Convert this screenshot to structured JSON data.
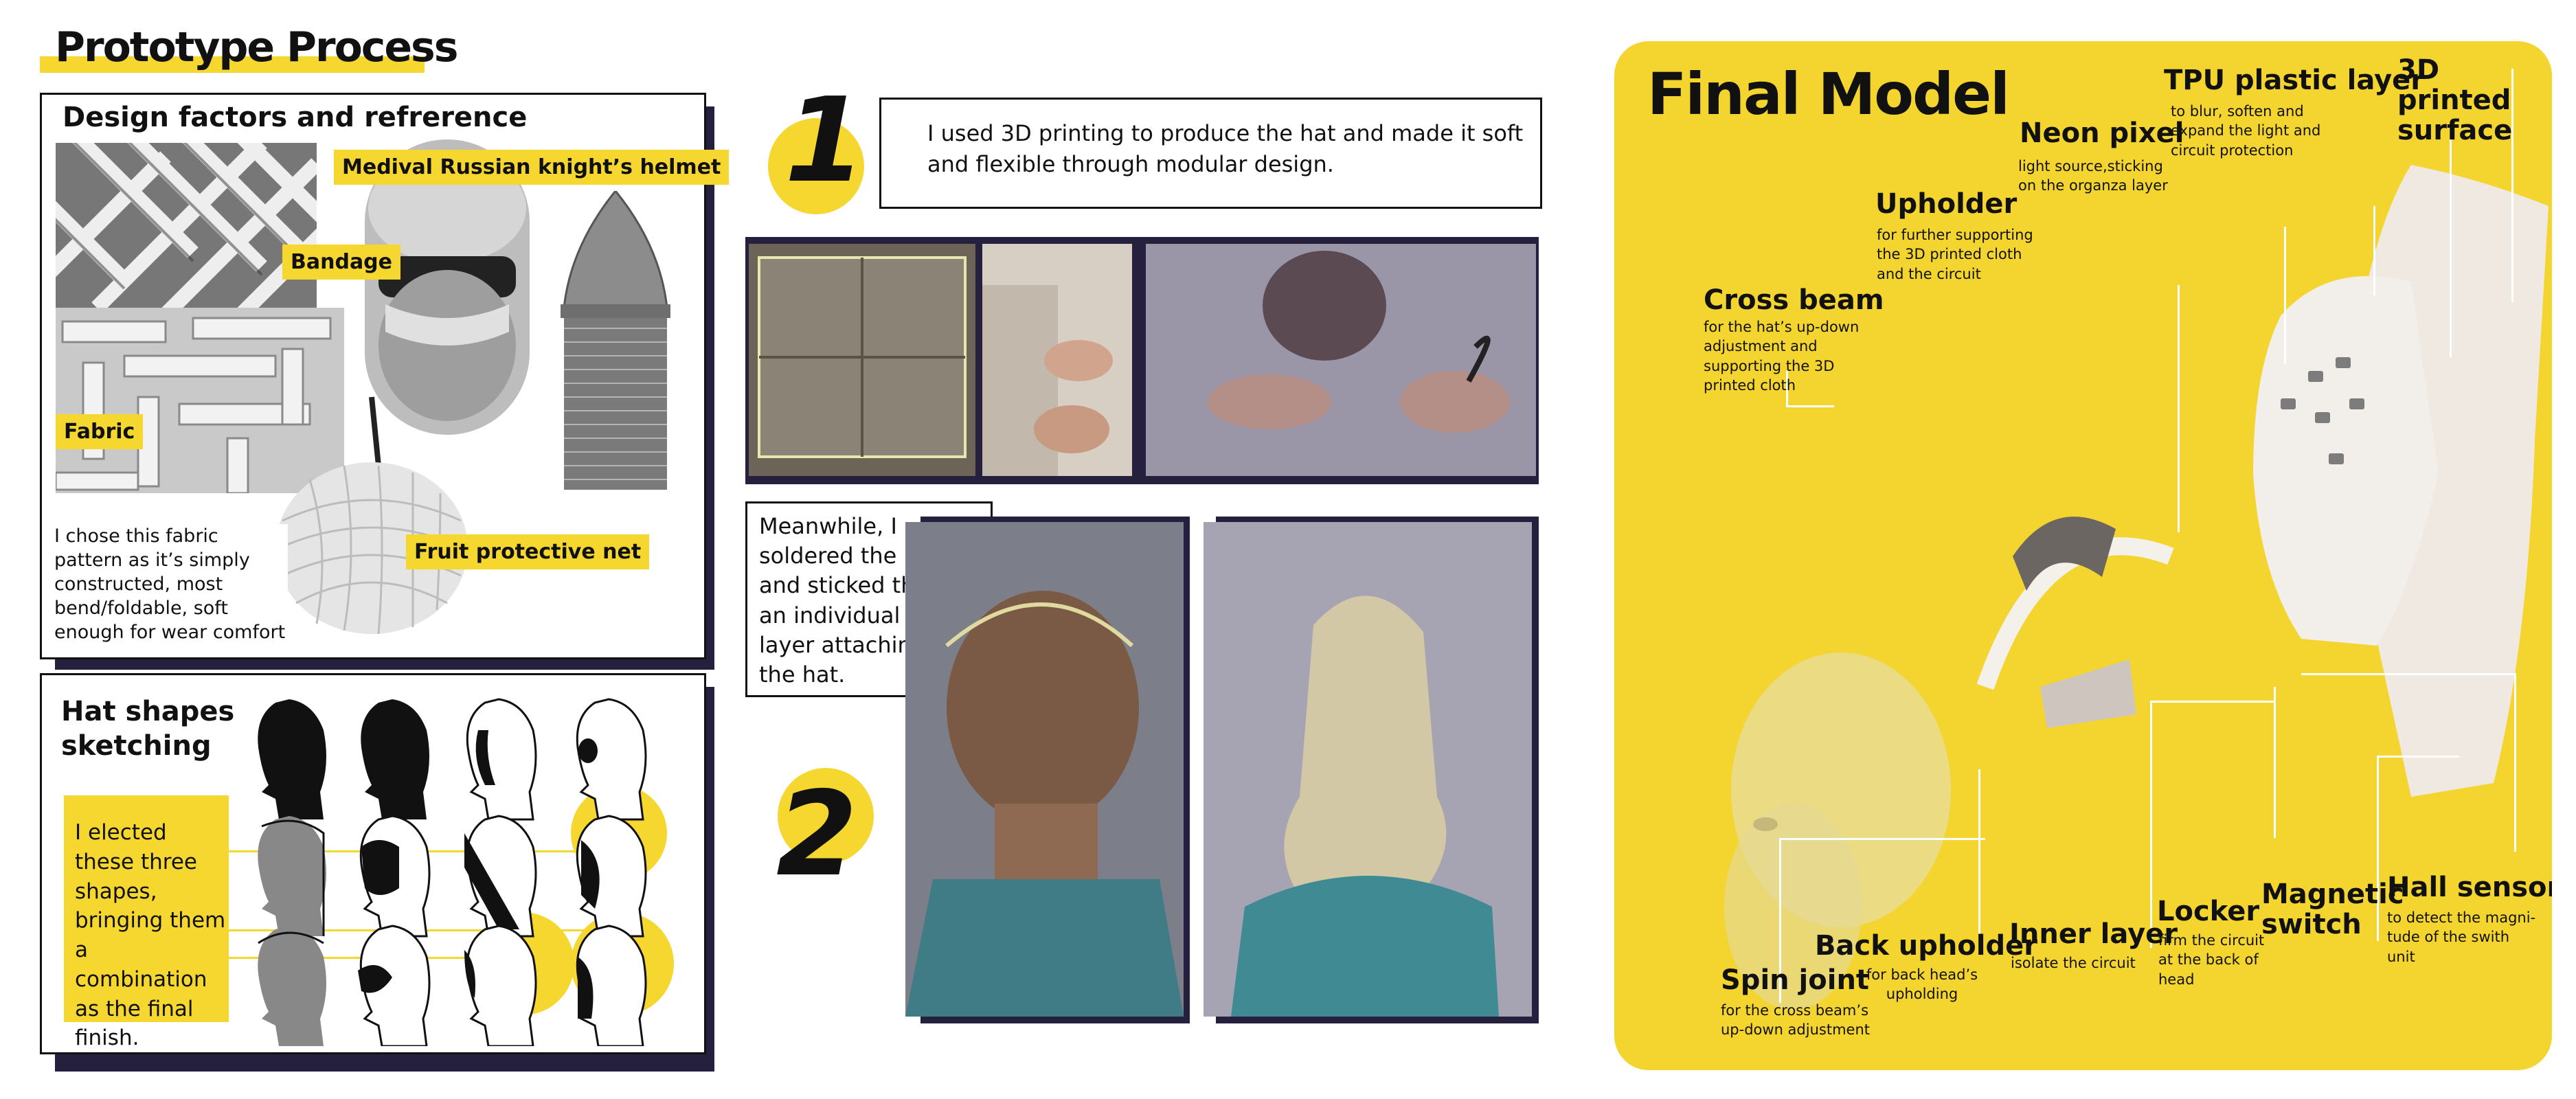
{
  "prototype": {
    "title": "Prototype Process",
    "design_factors": {
      "heading": "Design factors and refrerence",
      "labels": {
        "helmet": "Medival Russian knight’s helmet",
        "bandage": "Bandage",
        "fabric": "Fabric",
        "fruit_net": "Fruit protective net"
      },
      "note": "I chose this fabric pattern as it’s simply constructed, most bend/foldable, soft enough for wear comfort"
    },
    "hat_shapes": {
      "heading": "Hat shapes sketching",
      "note": "I elected these three shapes, bringing them a combination as the final finish."
    }
  },
  "steps": [
    {
      "number": "1",
      "text": "I used 3D printing to produce the hat and made it soft and flexible through modular design."
    },
    {
      "number": "2",
      "text": "Meanwhile, I soldered the LEDS and sticked them on an individual TPU layer attaching to the hat."
    }
  ],
  "final_model": {
    "title": "Final Model",
    "components": {
      "tpu": {
        "title": "TPU plastic layer",
        "desc": "to blur, soften and expand the light and circuit protection"
      },
      "surface": {
        "title": "3D printed surface",
        "desc": ""
      },
      "neon": {
        "title": "Neon pixel",
        "desc": "light source,sticking on the organza layer"
      },
      "upholder": {
        "title": "Upholder",
        "desc": "for further supporting the 3D printed cloth and the circuit"
      },
      "cross": {
        "title": "Cross beam",
        "desc": "for the hat’s up-down adjustment and supporting the 3D printed  cloth"
      },
      "spin": {
        "title": "Spin joint",
        "desc": "for the cross beam’s up-down adjustment"
      },
      "back": {
        "title": "Back upholder",
        "desc": "for back head’s upholding"
      },
      "inner": {
        "title": "Inner layer",
        "desc": "isolate the circuit"
      },
      "locker": {
        "title": "Locker",
        "desc": "firm the circuit at the back of head"
      },
      "magnetic": {
        "title": "Magnetic switch",
        "desc": ""
      },
      "hall": {
        "title": "Hall sensor",
        "desc": "to detect the magni-tude of the swith unit"
      }
    }
  },
  "colors": {
    "accent": "#f5d730",
    "navy": "#24203d",
    "panel_bg": "#f4d52f"
  }
}
